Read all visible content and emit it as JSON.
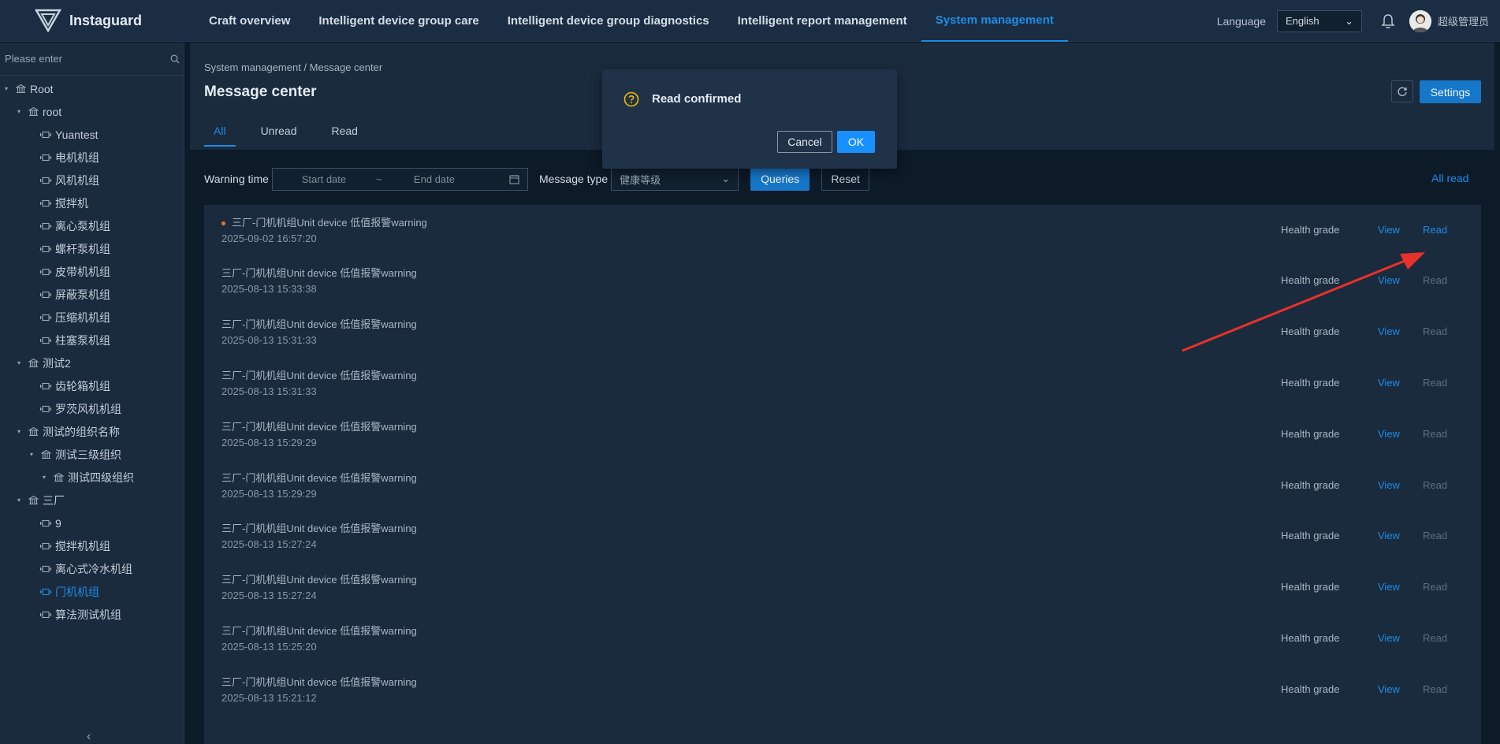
{
  "app": {
    "name": "Instaguard"
  },
  "nav": {
    "items": [
      {
        "label": "Craft overview"
      },
      {
        "label": "Intelligent device group care"
      },
      {
        "label": "Intelligent device group diagnostics"
      },
      {
        "label": "Intelligent report management"
      },
      {
        "label": "System management",
        "active": true
      }
    ]
  },
  "topright": {
    "language_label": "Language",
    "language_value": "English",
    "username": "超级管理员"
  },
  "sidebar": {
    "search_placeholder": "Please enter",
    "tree": [
      {
        "label": "Root",
        "type": "org",
        "level": 0,
        "expanded": true
      },
      {
        "label": "root",
        "type": "org",
        "level": 1,
        "expanded": true
      },
      {
        "label": "Yuantest",
        "type": "device",
        "level": 2
      },
      {
        "label": "电机机组",
        "type": "device",
        "level": 2
      },
      {
        "label": "风机机组",
        "type": "device",
        "level": 2
      },
      {
        "label": "搅拌机",
        "type": "device",
        "level": 2
      },
      {
        "label": "离心泵机组",
        "type": "device",
        "level": 2
      },
      {
        "label": "螺杆泵机组",
        "type": "device",
        "level": 2
      },
      {
        "label": "皮带机机组",
        "type": "device",
        "level": 2
      },
      {
        "label": "屏蔽泵机组",
        "type": "device",
        "level": 2
      },
      {
        "label": "压缩机机组",
        "type": "device",
        "level": 2
      },
      {
        "label": "柱塞泵机组",
        "type": "device",
        "level": 2
      },
      {
        "label": "测试2",
        "type": "org",
        "level": 1,
        "expanded": true
      },
      {
        "label": "齿轮箱机组",
        "type": "device",
        "level": 2
      },
      {
        "label": "罗茨风机机组",
        "type": "device",
        "level": 2
      },
      {
        "label": "测试的组织名称",
        "type": "org",
        "level": 1,
        "expanded": true
      },
      {
        "label": "测试三级组织",
        "type": "org",
        "level": 2,
        "expanded": true
      },
      {
        "label": "测试四级组织",
        "type": "org",
        "level": 3
      },
      {
        "label": "三厂",
        "type": "org",
        "level": 1,
        "expanded": true
      },
      {
        "label": "9",
        "type": "device",
        "level": 2
      },
      {
        "label": "搅拌机机组",
        "type": "device",
        "level": 2
      },
      {
        "label": "离心式冷水机组",
        "type": "device",
        "level": 2
      },
      {
        "label": "门机机组",
        "type": "device",
        "level": 2,
        "active": true
      },
      {
        "label": "算法测试机组",
        "type": "device",
        "level": 2
      }
    ]
  },
  "main": {
    "breadcrumb": "System management  /  Message center",
    "title": "Message center",
    "tabs": [
      {
        "label": "All",
        "active": true
      },
      {
        "label": "Unread"
      },
      {
        "label": "Read"
      }
    ],
    "settings_label": "Settings",
    "filters": {
      "warning_time_label": "Warning time",
      "start_placeholder": "Start date",
      "range_sep": "~",
      "end_placeholder": "End date",
      "message_type_label": "Message type",
      "message_type_value": "健康等级",
      "queries_label": "Queries",
      "reset_label": "Reset"
    },
    "all_read_label": "All read",
    "messages": [
      {
        "title": "三厂-门机机组Unit device 低值报警warning",
        "time": "2025-09-02 16:57:20",
        "grade": "Health grade",
        "view": "View",
        "read": "Read",
        "unread": true
      },
      {
        "title": "三厂-门机机组Unit device 低值报警warning",
        "time": "2025-08-13 15:33:38",
        "grade": "Health grade",
        "view": "View",
        "read": "Read"
      },
      {
        "title": "三厂-门机机组Unit device 低值报警warning",
        "time": "2025-08-13 15:31:33",
        "grade": "Health grade",
        "view": "View",
        "read": "Read"
      },
      {
        "title": "三厂-门机机组Unit device 低值报警warning",
        "time": "2025-08-13 15:31:33",
        "grade": "Health grade",
        "view": "View",
        "read": "Read"
      },
      {
        "title": "三厂-门机机组Unit device 低值报警warning",
        "time": "2025-08-13 15:29:29",
        "grade": "Health grade",
        "view": "View",
        "read": "Read"
      },
      {
        "title": "三厂-门机机组Unit device 低值报警warning",
        "time": "2025-08-13 15:29:29",
        "grade": "Health grade",
        "view": "View",
        "read": "Read"
      },
      {
        "title": "三厂-门机机组Unit device 低值报警warning",
        "time": "2025-08-13 15:27:24",
        "grade": "Health grade",
        "view": "View",
        "read": "Read"
      },
      {
        "title": "三厂-门机机组Unit device 低值报警warning",
        "time": "2025-08-13 15:27:24",
        "grade": "Health grade",
        "view": "View",
        "read": "Read"
      },
      {
        "title": "三厂-门机机组Unit device 低值报警warning",
        "time": "2025-08-13 15:25:20",
        "grade": "Health grade",
        "view": "View",
        "read": "Read"
      },
      {
        "title": "三厂-门机机组Unit device 低值报警warning",
        "time": "2025-08-13 15:21:12",
        "grade": "Health grade",
        "view": "View",
        "read": "Read"
      }
    ]
  },
  "modal": {
    "title": "Read confirmed",
    "cancel_label": "Cancel",
    "ok_label": "OK"
  },
  "colors": {
    "accent": "#1f8ce6",
    "primary_button": "#1677c9",
    "annotation_arrow": "#e8312a",
    "warning_icon": "#f5b800"
  }
}
